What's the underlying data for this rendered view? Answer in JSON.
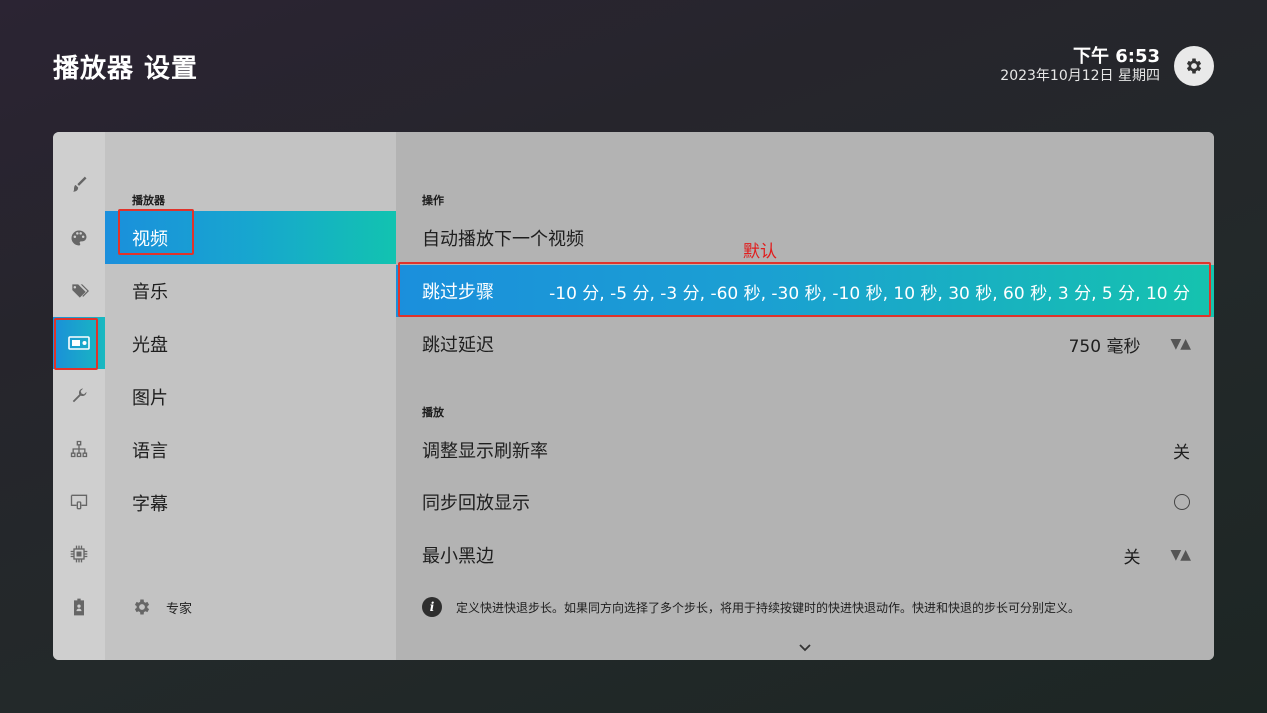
{
  "header": {
    "title": "播放器 设置",
    "time": "下午 6:53",
    "date": "2023年10月12日 星期四",
    "settings_icon": "gear-icon"
  },
  "sidebar_icons": [
    {
      "name": "appearance-brush-icon"
    },
    {
      "name": "skins-palette-icon"
    },
    {
      "name": "media-tags-icon"
    },
    {
      "name": "player-icon",
      "active": true
    },
    {
      "name": "services-wrench-icon"
    },
    {
      "name": "network-icon"
    },
    {
      "name": "interface-display-icon"
    },
    {
      "name": "system-chip-icon"
    },
    {
      "name": "profiles-badge-icon"
    }
  ],
  "categories": {
    "section": "播放器",
    "items": [
      "视频",
      "音乐",
      "光盘",
      "图片",
      "语言",
      "字幕"
    ],
    "active_index": 0,
    "expert_label": "专家"
  },
  "main": {
    "section_operation": "操作",
    "section_playback": "播放",
    "rows": {
      "autoplay": {
        "label": "自动播放下一个视频"
      },
      "skip_steps": {
        "label": "跳过步骤",
        "value": "-10 分, -5 分, -3 分, -60 秒, -30 秒, -10 秒, 10 秒, 30 秒, 60 秒, 3 分, 5 分, 10 分"
      },
      "skip_delay": {
        "label": "跳过延迟",
        "value": "750 毫秒"
      },
      "refresh_rate": {
        "label": "调整显示刷新率",
        "value": "关"
      },
      "sync_display": {
        "label": "同步回放显示"
      },
      "min_black_bars": {
        "label": "最小黑边",
        "value": "关"
      }
    },
    "info_text": "定义快进快退步长。如果同方向选择了多个步长，将用于持续按键时的快进快退动作。快进和快退的步长可分别定义。",
    "arrows_glyph": "▼▲"
  },
  "annotation": {
    "text": "默认",
    "color": "#e11d1d"
  },
  "colors": {
    "accent_start": "#1b8fdc",
    "accent_end": "#15c3ae",
    "highlight_box": "#e0332b"
  }
}
